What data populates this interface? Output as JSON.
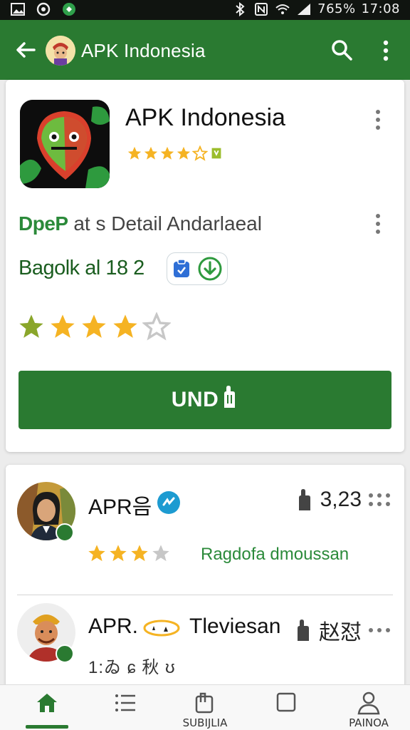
{
  "status_bar": {
    "battery": "765%",
    "time": "17:08"
  },
  "app_bar": {
    "title": "APK Indonesia"
  },
  "app": {
    "name": "APK Indonesia",
    "detail_brand": "DpeP",
    "detail_rest": " at s Detail Andarlaeal",
    "version_text": "Bagolk al 18 2",
    "rating_stars": 4,
    "install_label": "UND"
  },
  "reviews": [
    {
      "name": "APR음",
      "likes": "3,23",
      "stars": 3,
      "note": "Ragdofa dmoussan"
    },
    {
      "name": "APR.",
      "name_after": "Tleviesan",
      "likes": "赵怼",
      "sub": "1:ゐ ɕ 秋 ʊ"
    }
  ],
  "bottom_nav": [
    {
      "label": ""
    },
    {
      "label": ""
    },
    {
      "label": "SUBIJLIA"
    },
    {
      "label": ""
    },
    {
      "label": "PAINOA"
    }
  ],
  "colors": {
    "primary": "#2a7a31",
    "star": "#f5b323",
    "star_green": "#8aa62a",
    "empty_star": "#c7c7c7"
  }
}
